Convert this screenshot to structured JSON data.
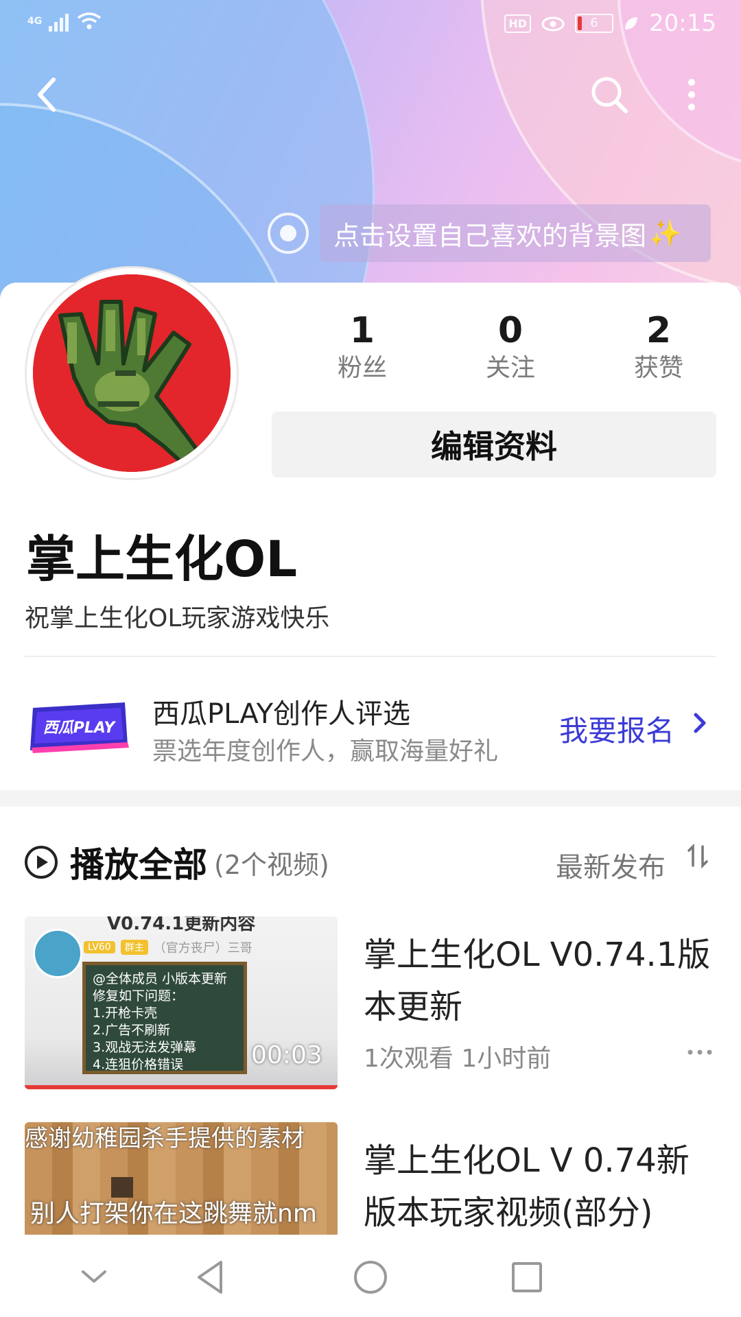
{
  "status_bar": {
    "network": "4G",
    "hd": "HD",
    "battery": "6",
    "time": "20:15"
  },
  "header": {
    "background_hint": "点击设置自己喜欢的背景图",
    "sparkle": "✨"
  },
  "profile": {
    "stats": [
      {
        "value": "1",
        "label": "粉丝"
      },
      {
        "value": "0",
        "label": "关注"
      },
      {
        "value": "2",
        "label": "获赞"
      }
    ],
    "edit_button": "编辑资料",
    "name": "掌上生化OL",
    "bio": "祝掌上生化OL玩家游戏快乐"
  },
  "promo": {
    "logo_text": "西瓜PLAY",
    "title": "西瓜PLAY创作人评选",
    "subtitle": "票选年度创作人，赢取海量好礼",
    "cta": "我要报名"
  },
  "video_list": {
    "play_all_label": "播放全部",
    "count_label": "(2个视频)",
    "sort_label": "最新发布"
  },
  "videos": [
    {
      "title": "掌上生化OL V0.74.1版本更新",
      "meta": "1次观看  1小时前",
      "duration": "00:03",
      "thumb_top_text": "V0.74.1更新内容",
      "thumb_level": "LV60",
      "thumb_role": "群主",
      "thumb_user": "（官方丧尸）三哥",
      "thumb_board_lines": [
        "@全体成员 小版本更新",
        "修复如下问题：",
        "1.开枪卡壳",
        "2.广告不刷新",
        "3.观战无法发弹幕",
        "4.连狙价格错误"
      ]
    },
    {
      "title": "掌上生化OL V 0.74新版本玩家视频(部分)",
      "thumb_top_text": "感谢幼稚园杀手提供的素材",
      "thumb_sub_text": "别人打架你在这跳舞就nm"
    }
  ],
  "colors": {
    "accent": "#3b3bd6",
    "progress": "#e53935",
    "avatar_bg": "#e3262b"
  }
}
